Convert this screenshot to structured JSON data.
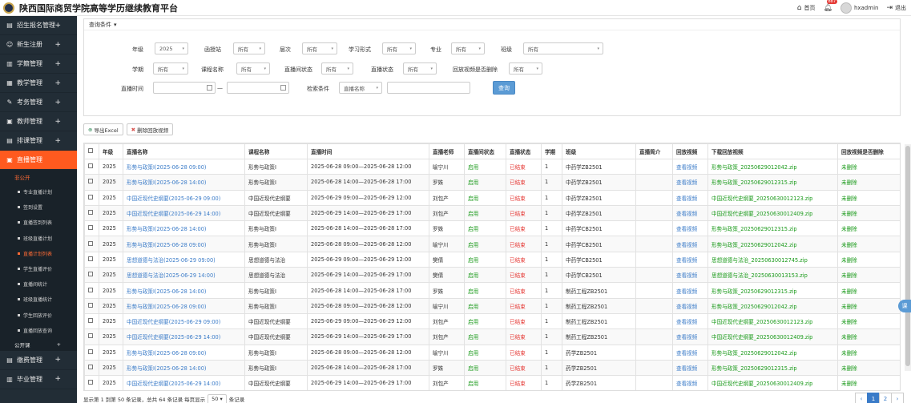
{
  "header": {
    "title": "陕西国际商贸学院高等学历继续教育平台",
    "home_label": "首页",
    "notification_count": "887",
    "username": "hxadmin",
    "logout_label": "退出"
  },
  "sidebar": {
    "items_top": [
      {
        "icon": "▤",
        "label": "招生报名管理"
      },
      {
        "icon": "☺",
        "label": "新生注册"
      },
      {
        "icon": "▥",
        "label": "学籍管理"
      },
      {
        "icon": "▦",
        "label": "教学管理"
      },
      {
        "icon": "✎",
        "label": "考务管理"
      },
      {
        "icon": "▣",
        "label": "教师管理"
      },
      {
        "icon": "▤",
        "label": "排课管理"
      }
    ],
    "active_item": {
      "icon": "▣",
      "label": "直播管理"
    },
    "sub_group": "非公开",
    "sub_items": [
      "专业直播计划",
      "签到设置",
      "直播签到列表",
      "班级直播计划",
      "直播计划列表",
      "学生直播评价",
      "直播间统计",
      "班级直播统计",
      "学生回放评价",
      "直播回放查询"
    ],
    "sub_group2": "公开课",
    "items_bottom": [
      {
        "icon": "▤",
        "label": "缴费管理"
      },
      {
        "icon": "▥",
        "label": "毕业管理"
      }
    ]
  },
  "filter": {
    "head": "查询条件",
    "labels": {
      "year": "年级",
      "site": "函授站",
      "level": "层次",
      "mode": "学习形式",
      "major": "专业",
      "class": "班级",
      "term": "学期",
      "course": "课程名称",
      "room_status": "直播间状态",
      "live_status": "直播状态",
      "replay_deleted": "回放视频是否删除",
      "live_time": "直播时间",
      "search_cond": "检索条件"
    },
    "values": {
      "year": "2025",
      "site": "所有",
      "level": "所有",
      "mode": "所有",
      "major": "所有",
      "class": "所有",
      "term": "所有",
      "course": "所有",
      "room_status": "所有",
      "live_status": "所有",
      "replay_deleted": "所有",
      "search_field": "直播名称"
    },
    "date_sep": "—",
    "query_button": "查询"
  },
  "toolbar": {
    "export_label": "导出Excel",
    "delete_label": "删除回放视频"
  },
  "table": {
    "headers": [
      "",
      "年级",
      "直播名称",
      "课程名称",
      "直播时间",
      "直播老师",
      "直播间状态",
      "直播状态",
      "学期",
      "班级",
      "直播简介",
      "回放视频",
      "下载回放视频",
      "回放视频是否删除"
    ],
    "rows": [
      [
        "2025",
        "形势与政策Ⅰ(2025-06-28 09:00)",
        "形势与政策Ⅰ",
        "2025-06-28 09:00—2025-06-28 12:00",
        "喻宁川",
        "启用",
        "已结束",
        "1",
        "中药学ZB2501",
        "",
        "查看视频",
        "形势与政策_20250629012042.zip",
        "未删除"
      ],
      [
        "2025",
        "形势与政策Ⅰ(2025-06-28 14:00)",
        "形势与政策Ⅰ",
        "2025-06-28 14:00—2025-06-28 17:00",
        "罗姝",
        "启用",
        "已结束",
        "1",
        "中药学ZB2501",
        "",
        "查看视频",
        "形势与政策_20250629012315.zip",
        "未删除"
      ],
      [
        "2025",
        "中国近现代史纲要(2025-06-29 09:00)",
        "中国近现代史纲要",
        "2025-06-29 09:00—2025-06-29 12:00",
        "刘包产",
        "启用",
        "已结束",
        "1",
        "中药学ZB2501",
        "",
        "查看视频",
        "中国近现代史纲要_20250630012123.zip",
        "未删除"
      ],
      [
        "2025",
        "中国近现代史纲要(2025-06-29 14:00)",
        "中国近现代史纲要",
        "2025-06-29 14:00—2025-06-29 17:00",
        "刘包产",
        "启用",
        "已结束",
        "1",
        "中药学ZB2501",
        "",
        "查看视频",
        "中国近现代史纲要_20250630012409.zip",
        "未删除"
      ],
      [
        "2025",
        "形势与政策Ⅰ(2025-06-28 14:00)",
        "形势与政策Ⅰ",
        "2025-06-28 14:00—2025-06-28 17:00",
        "罗姝",
        "启用",
        "已结束",
        "1",
        "中药学CB2501",
        "",
        "查看视频",
        "形势与政策_20250629012315.zip",
        "未删除"
      ],
      [
        "2025",
        "形势与政策Ⅰ(2025-06-28 09:00)",
        "形势与政策Ⅰ",
        "2025-06-28 09:00—2025-06-28 12:00",
        "喻宁川",
        "启用",
        "已结束",
        "1",
        "中药学CB2501",
        "",
        "查看视频",
        "形势与政策_20250629012042.zip",
        "未删除"
      ],
      [
        "2025",
        "思想道德与法治(2025-06-29 09:00)",
        "思想道德与法治",
        "2025-06-29 09:00—2025-06-29 12:00",
        "樊倩",
        "启用",
        "已结束",
        "1",
        "中药学CB2501",
        "",
        "查看视频",
        "思想道德与法治_20250630012745.zip",
        "未删除"
      ],
      [
        "2025",
        "思想道德与法治(2025-06-29 14:00)",
        "思想道德与法治",
        "2025-06-29 14:00—2025-06-29 17:00",
        "樊倩",
        "启用",
        "已结束",
        "1",
        "中药学CB2501",
        "",
        "查看视频",
        "思想道德与法治_20250630013153.zip",
        "未删除"
      ],
      [
        "2025",
        "形势与政策Ⅰ(2025-06-28 14:00)",
        "形势与政策Ⅰ",
        "2025-06-28 14:00—2025-06-28 17:00",
        "罗姝",
        "启用",
        "已结束",
        "1",
        "制药工程ZB2501",
        "",
        "查看视频",
        "形势与政策_20250629012315.zip",
        "未删除"
      ],
      [
        "2025",
        "形势与政策Ⅰ(2025-06-28 09:00)",
        "形势与政策Ⅰ",
        "2025-06-28 09:00—2025-06-28 12:00",
        "喻宁川",
        "启用",
        "已结束",
        "1",
        "制药工程ZB2501",
        "",
        "查看视频",
        "形势与政策_20250629012042.zip",
        "未删除"
      ],
      [
        "2025",
        "中国近现代史纲要(2025-06-29 09:00)",
        "中国近现代史纲要",
        "2025-06-29 09:00—2025-06-29 12:00",
        "刘包产",
        "启用",
        "已结束",
        "1",
        "制药工程ZB2501",
        "",
        "查看视频",
        "中国近现代史纲要_20250630012123.zip",
        "未删除"
      ],
      [
        "2025",
        "中国近现代史纲要(2025-06-29 14:00)",
        "中国近现代史纲要",
        "2025-06-29 14:00—2025-06-29 17:00",
        "刘包产",
        "启用",
        "已结束",
        "1",
        "制药工程ZB2501",
        "",
        "查看视频",
        "中国近现代史纲要_20250630012409.zip",
        "未删除"
      ],
      [
        "2025",
        "形势与政策Ⅰ(2025-06-28 09:00)",
        "形势与政策Ⅰ",
        "2025-06-28 09:00—2025-06-28 12:00",
        "喻宁川",
        "启用",
        "已结束",
        "1",
        "药学ZB2501",
        "",
        "查看视频",
        "形势与政策_20250629012042.zip",
        "未删除"
      ],
      [
        "2025",
        "形势与政策Ⅰ(2025-06-28 14:00)",
        "形势与政策Ⅰ",
        "2025-06-28 14:00—2025-06-28 17:00",
        "罗姝",
        "启用",
        "已结束",
        "1",
        "药学ZB2501",
        "",
        "查看视频",
        "形势与政策_20250629012315.zip",
        "未删除"
      ],
      [
        "2025",
        "中国近现代史纲要(2025-06-29 14:00)",
        "中国近现代史纲要",
        "2025-06-29 14:00—2025-06-29 17:00",
        "刘包产",
        "启用",
        "已结束",
        "1",
        "药学ZB2501",
        "",
        "查看视频",
        "中国近现代史纲要_20250630012409.zip",
        "未删除"
      ]
    ]
  },
  "footer": {
    "summary_prefix": "显示第 1 到第 50 条记录，总共 64 条记录  每页显示",
    "page_size": "50",
    "summary_suffix": "条记录",
    "pages": [
      "‹",
      "1",
      "2",
      "›"
    ],
    "current_page": "1"
  },
  "floating_button": "课",
  "colors": {
    "sidebar_bg": "#222d36",
    "active_orange": "#ff5a1f",
    "link_blue": "#3a7bc8",
    "status_green": "#1a9a1a",
    "status_red": "#e53935"
  }
}
